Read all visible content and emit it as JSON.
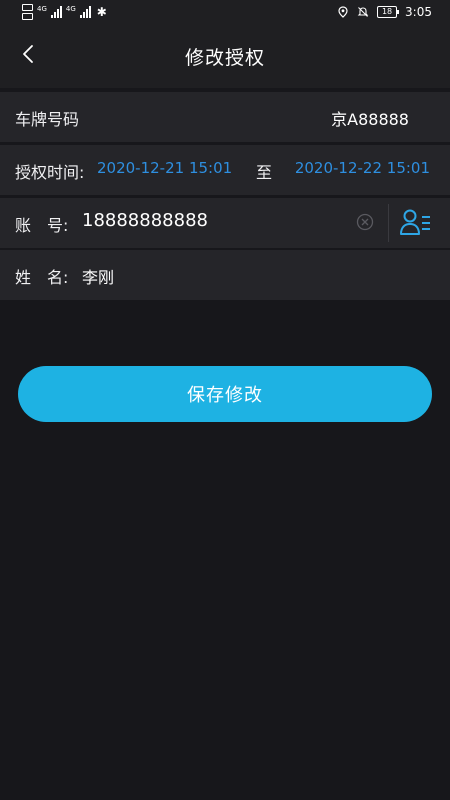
{
  "status_bar": {
    "sim1_network": "4G",
    "sim2_network": "4G",
    "battery_level": "18",
    "time": "3:05",
    "bluetooth_icon": "bluetooth-icon",
    "location_icon": "location-icon",
    "mute_icon": "bell-off-icon"
  },
  "header": {
    "title": "修改授权",
    "back_icon": "chevron-left-icon"
  },
  "form": {
    "plate": {
      "label": "车牌号码",
      "value": "京A88888"
    },
    "auth_time": {
      "label": "授权时间:",
      "start": "2020-12-21 15:01",
      "separator": "至",
      "end": "2020-12-22 15:01"
    },
    "account": {
      "label": "账　号:",
      "value": "18888888888",
      "clear_icon": "clear-icon",
      "contact_icon": "contact-list-icon"
    },
    "name": {
      "label": "姓　名:",
      "value": "李刚"
    }
  },
  "actions": {
    "save_label": "保存修改"
  },
  "colors": {
    "background": "#17171b",
    "row_background": "#252529",
    "accent_blue": "#2e8fe0",
    "button": "#1eb2e3"
  }
}
